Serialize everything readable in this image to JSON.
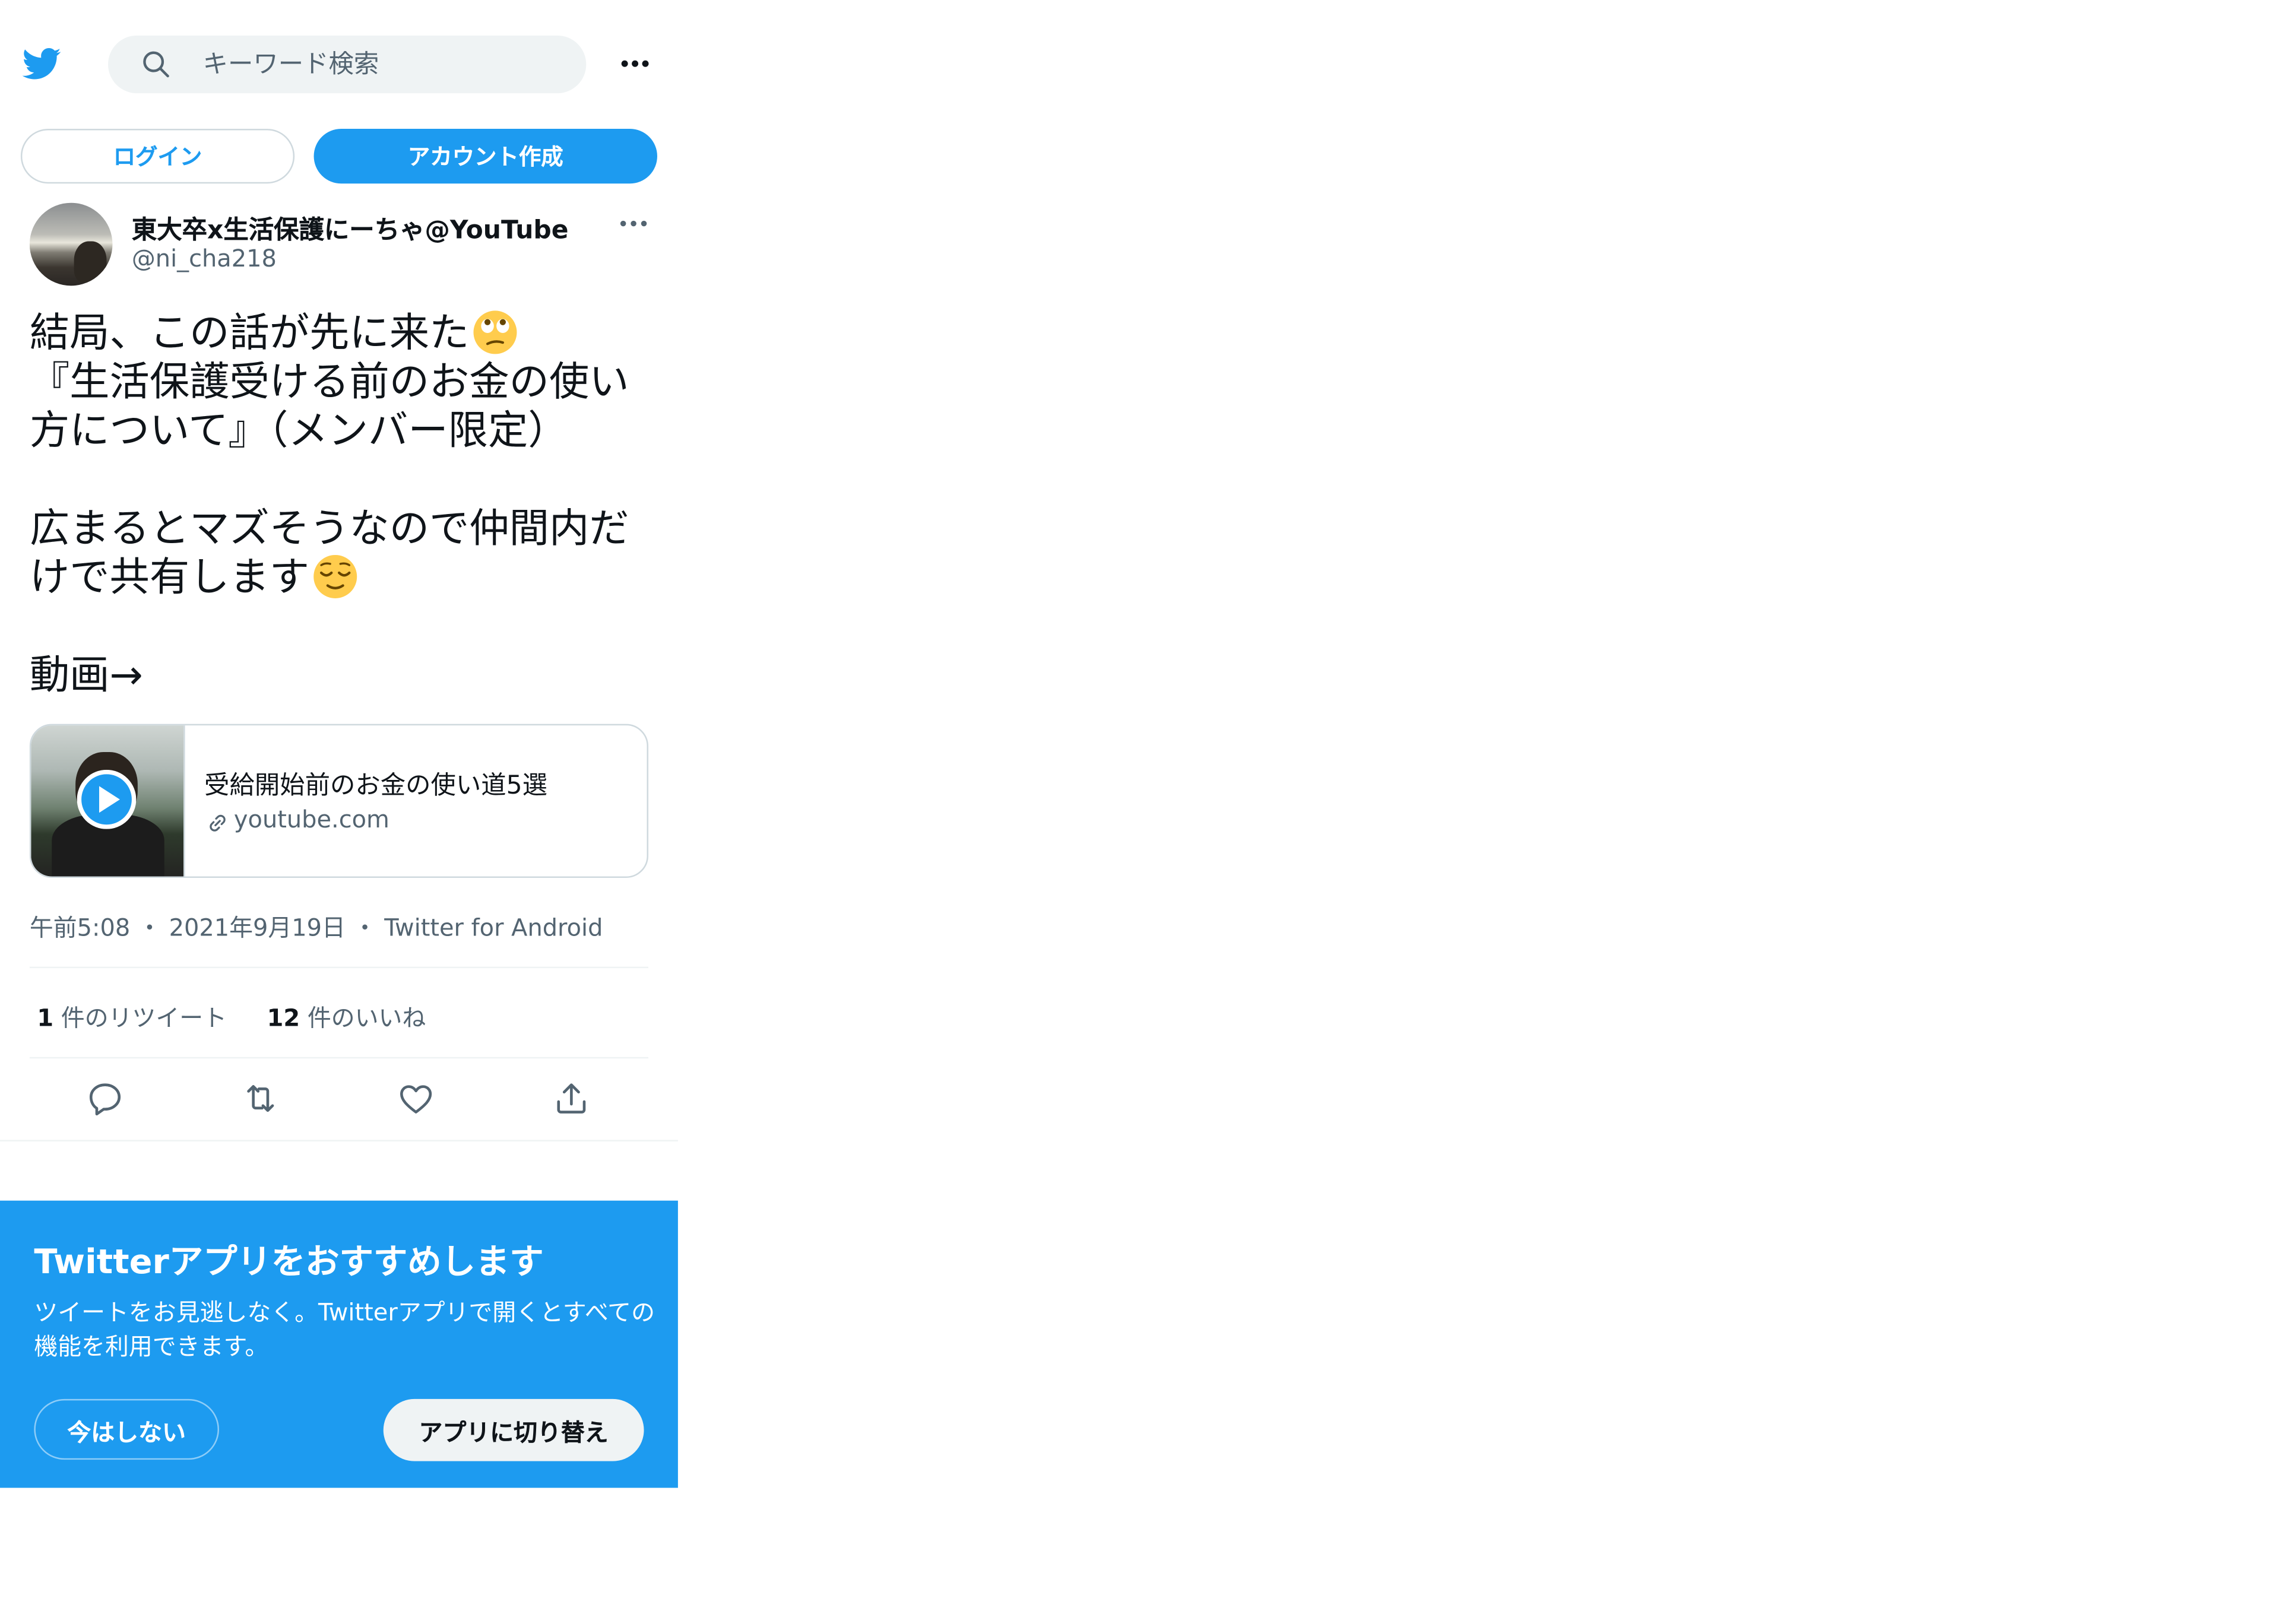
{
  "header": {
    "search_placeholder": "キーワード検索"
  },
  "auth": {
    "login_label": "ログイン",
    "signup_label": "アカウント作成"
  },
  "tweet": {
    "display_name": "東大卒x生活保護にーちゃ@YouTube",
    "handle": "@ni_cha218",
    "text_line1": "結局、この話が先に来た",
    "text_line1_emoji": "face-with-rolling-eyes",
    "text_line2": "『生活保護受ける前のお金の使い方について』（メンバー限定）",
    "text_line3": "広まるとマズそうなので仲間内だけで共有します",
    "text_line3_emoji": "relieved-face",
    "text_line4": "動画→",
    "card": {
      "title": "受給開始前のお金の使い道5選",
      "domain": "youtube.com"
    },
    "time": "午前5:08",
    "date": "2021年9月19日",
    "source": "Twitter for Android",
    "retweet_count": "1",
    "retweet_label": "件のリツイート",
    "like_count": "12",
    "like_label": "件のいいね"
  },
  "app_banner": {
    "title": "Twitterアプリをおすすめします",
    "body": "ツイートをお見逃しなく。Twitterアプリで開くとすべての機能を利用できます。",
    "not_now_label": "今はしない",
    "switch_label": "アプリに切り替え"
  },
  "colors": {
    "brand_blue": "#1d9bf0",
    "text_primary": "#0f1419",
    "text_secondary": "#536471",
    "border": "#cfd9de"
  }
}
